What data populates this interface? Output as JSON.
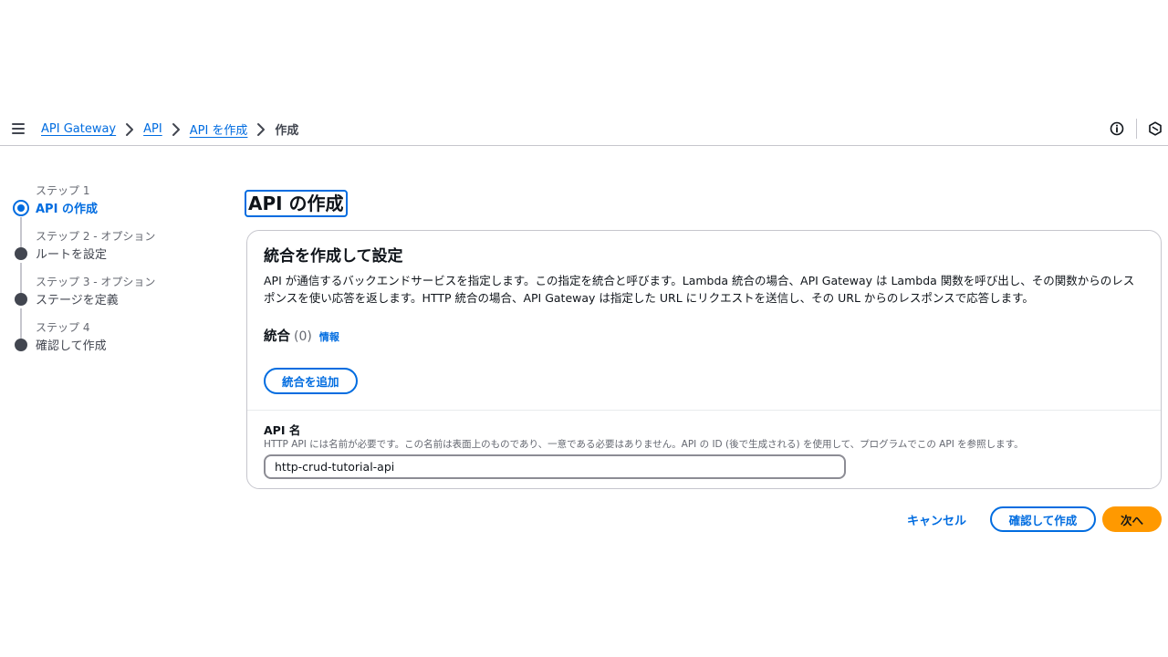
{
  "breadcrumb": {
    "items": [
      "API Gateway",
      "API",
      "API を作成"
    ],
    "current": "作成"
  },
  "icons": {
    "menu": "hamburger-menu-icon",
    "info": "info-circle-icon",
    "tools": "tools-hexagon-icon",
    "separator": "chevron-right-icon"
  },
  "steps": [
    {
      "number": "ステップ 1",
      "title": "API の作成",
      "active": true
    },
    {
      "number": "ステップ 2 - オプション",
      "title": "ルートを設定",
      "active": false
    },
    {
      "number": "ステップ 3 - オプション",
      "title": "ステージを定義",
      "active": false
    },
    {
      "number": "ステップ 4",
      "title": "確認して作成",
      "active": false
    }
  ],
  "page": {
    "title": "API の作成"
  },
  "card": {
    "title": "統合を作成して設定",
    "description": "API が通信するバックエンドサービスを指定します。この指定を統合と呼びます。Lambda 統合の場合、API Gateway は Lambda 関数を呼び出し、その関数からのレスポンスを使い応答を返します。HTTP 統合の場合、API Gateway は指定した URL にリクエストを送信し、その URL からのレスポンスで応答します。",
    "integrations": {
      "title": "統合",
      "count": "(0)",
      "info_link": "情報",
      "add_button": "統合を追加"
    },
    "api_name": {
      "label": "API 名",
      "description": "HTTP API には名前が必要です。この名前は表面上のものであり、一意である必要はありません。API の ID (後で生成される) を使用して、プログラムでこの API を参照します。",
      "value": "http-crud-tutorial-api"
    }
  },
  "footer": {
    "cancel": "キャンセル",
    "review": "確認して作成",
    "next": "次へ"
  },
  "colors": {
    "accent": "#006ce0",
    "primary_button": "#ff9900",
    "text": "#0f141a",
    "secondary_text": "#656871",
    "border": "#c6c6cd"
  }
}
